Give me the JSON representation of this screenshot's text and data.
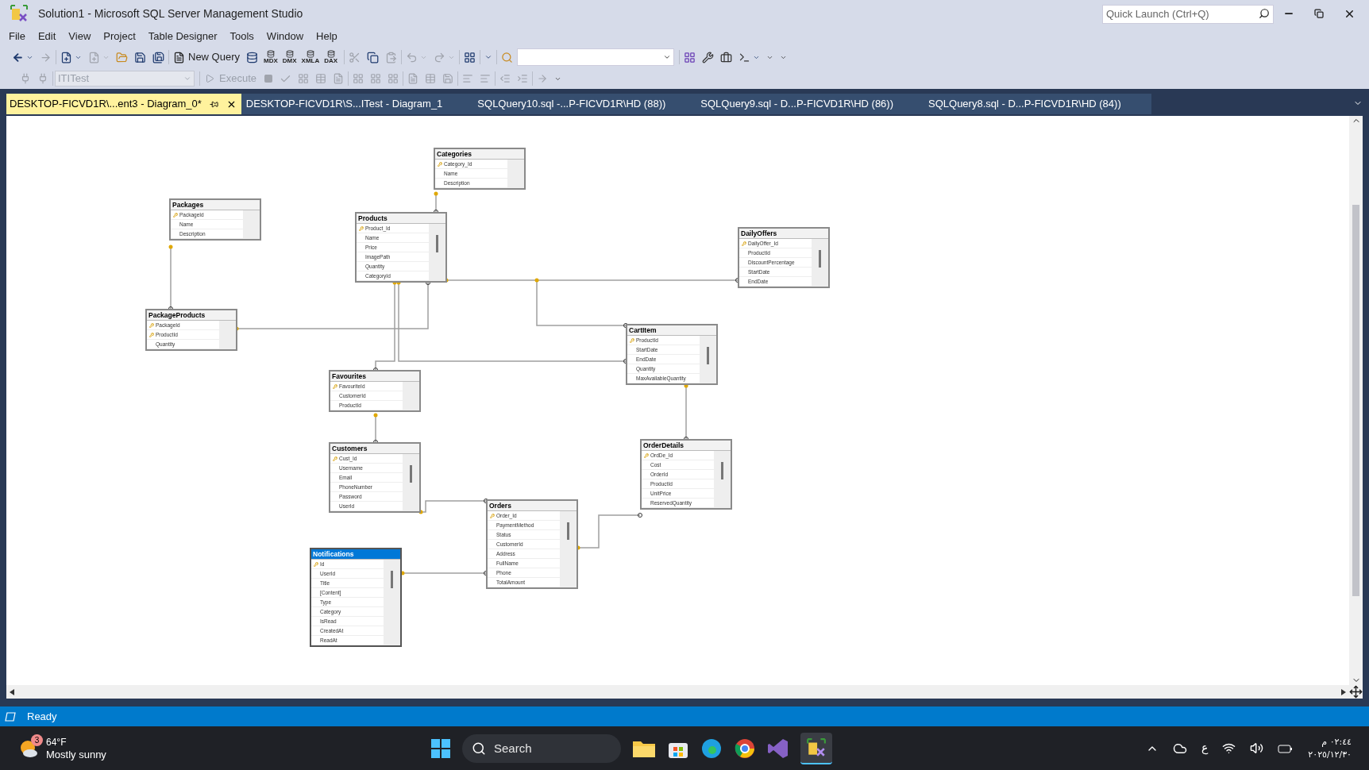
{
  "window": {
    "title": "Solution1 - Microsoft SQL Server Management Studio"
  },
  "quick_launch": {
    "placeholder": "Quick Launch (Ctrl+Q)"
  },
  "menu": [
    "File",
    "Edit",
    "View",
    "Project",
    "Table Designer",
    "Tools",
    "Window",
    "Help"
  ],
  "toolbar": {
    "new_query": "New Query",
    "query_types": [
      "MDX",
      "DMX",
      "XMLA",
      "DAX"
    ]
  },
  "sql_toolbar": {
    "database": {
      "value": "ITITest",
      "disabled": true
    },
    "execute": {
      "label": "Execute",
      "disabled": true
    }
  },
  "tabs": [
    {
      "label": "DESKTOP-FICVD1R\\...ent3 - Diagram_0*",
      "selected": true
    },
    {
      "label": "DESKTOP-FICVD1R\\S...ITest - Diagram_1",
      "selected": false
    },
    {
      "label": "SQLQuery10.sql -...P-FICVD1R\\HD (88))",
      "selected": false
    },
    {
      "label": "SQLQuery9.sql - D...P-FICVD1R\\HD (86))",
      "selected": false
    },
    {
      "label": "SQLQuery8.sql - D...P-FICVD1R\\HD (84))",
      "selected": false
    }
  ],
  "diagram": {
    "tables": [
      {
        "name": "Categories",
        "selected": false,
        "columns": [
          {
            "name": "Category_Id",
            "key": true
          },
          {
            "name": "Name",
            "key": false
          },
          {
            "name": "Description",
            "key": false
          }
        ]
      },
      {
        "name": "Packages",
        "selected": false,
        "columns": [
          {
            "name": "PackageId",
            "key": true
          },
          {
            "name": "Name",
            "key": false
          },
          {
            "name": "Description",
            "key": false
          }
        ]
      },
      {
        "name": "Products",
        "selected": false,
        "columns": [
          {
            "name": "Product_Id",
            "key": true
          },
          {
            "name": "Name",
            "key": false
          },
          {
            "name": "Price",
            "key": false
          },
          {
            "name": "ImagePath",
            "key": false
          },
          {
            "name": "Quantity",
            "key": false
          },
          {
            "name": "CategoryId",
            "key": false
          }
        ]
      },
      {
        "name": "DailyOffers",
        "selected": false,
        "columns": [
          {
            "name": "DailyOffer_Id",
            "key": true
          },
          {
            "name": "ProductId",
            "key": false
          },
          {
            "name": "DiscountPercentage",
            "key": false
          },
          {
            "name": "StartDate",
            "key": false
          },
          {
            "name": "EndDate",
            "key": false
          }
        ]
      },
      {
        "name": "PackageProducts",
        "selected": false,
        "columns": [
          {
            "name": "PackageId",
            "key": true
          },
          {
            "name": "ProductId",
            "key": true
          },
          {
            "name": "Quantity",
            "key": false
          }
        ]
      },
      {
        "name": "CartItem",
        "selected": false,
        "columns": [
          {
            "name": "ProductId",
            "key": true
          },
          {
            "name": "StartDate",
            "key": false
          },
          {
            "name": "EndDate",
            "key": false
          },
          {
            "name": "Quantity",
            "key": false
          },
          {
            "name": "MaxAvailableQuantity",
            "key": false
          }
        ]
      },
      {
        "name": "Favourites",
        "selected": false,
        "columns": [
          {
            "name": "FavouriteId",
            "key": true
          },
          {
            "name": "CustomerId",
            "key": false
          },
          {
            "name": "ProductId",
            "key": false
          }
        ]
      },
      {
        "name": "Customers",
        "selected": false,
        "columns": [
          {
            "name": "Cust_Id",
            "key": true
          },
          {
            "name": "Username",
            "key": false
          },
          {
            "name": "Email",
            "key": false
          },
          {
            "name": "PhoneNumber",
            "key": false
          },
          {
            "name": "Password",
            "key": false
          },
          {
            "name": "UserId",
            "key": false
          }
        ]
      },
      {
        "name": "OrderDetails",
        "selected": false,
        "columns": [
          {
            "name": "OrdDe_Id",
            "key": true
          },
          {
            "name": "Cost",
            "key": false
          },
          {
            "name": "OrderId",
            "key": false
          },
          {
            "name": "ProductId",
            "key": false
          },
          {
            "name": "UnitPrice",
            "key": false
          },
          {
            "name": "ReservedQuantity",
            "key": false
          }
        ]
      },
      {
        "name": "Orders",
        "selected": false,
        "columns": [
          {
            "name": "Order_Id",
            "key": true
          },
          {
            "name": "PaymentMethod",
            "key": false
          },
          {
            "name": "Status",
            "key": false
          },
          {
            "name": "CustomerId",
            "key": false
          },
          {
            "name": "Address",
            "key": false
          },
          {
            "name": "FullName",
            "key": false
          },
          {
            "name": "Phone",
            "key": false
          },
          {
            "name": "TotalAmount",
            "key": false
          }
        ]
      },
      {
        "name": "Notifications",
        "selected": true,
        "columns": [
          {
            "name": "Id",
            "key": true
          },
          {
            "name": "UserId",
            "key": false
          },
          {
            "name": "Title",
            "key": false
          },
          {
            "name": "[Content]",
            "key": false
          },
          {
            "name": "Type",
            "key": false
          },
          {
            "name": "Category",
            "key": false
          },
          {
            "name": "IsRead",
            "key": false
          },
          {
            "name": "CreatedAt",
            "key": false
          },
          {
            "name": "ReadAt",
            "key": false
          }
        ]
      }
    ]
  },
  "status_bar": {
    "text": "Ready"
  },
  "taskbar": {
    "weather": {
      "badge": "3",
      "temperature": "64°F",
      "condition": "Mostly sunny"
    },
    "search": {
      "placeholder": "Search"
    },
    "language": "ع",
    "time": "٠٢:٤٤ م",
    "date": "٢٠٢٥/١٢/٣٠"
  }
}
